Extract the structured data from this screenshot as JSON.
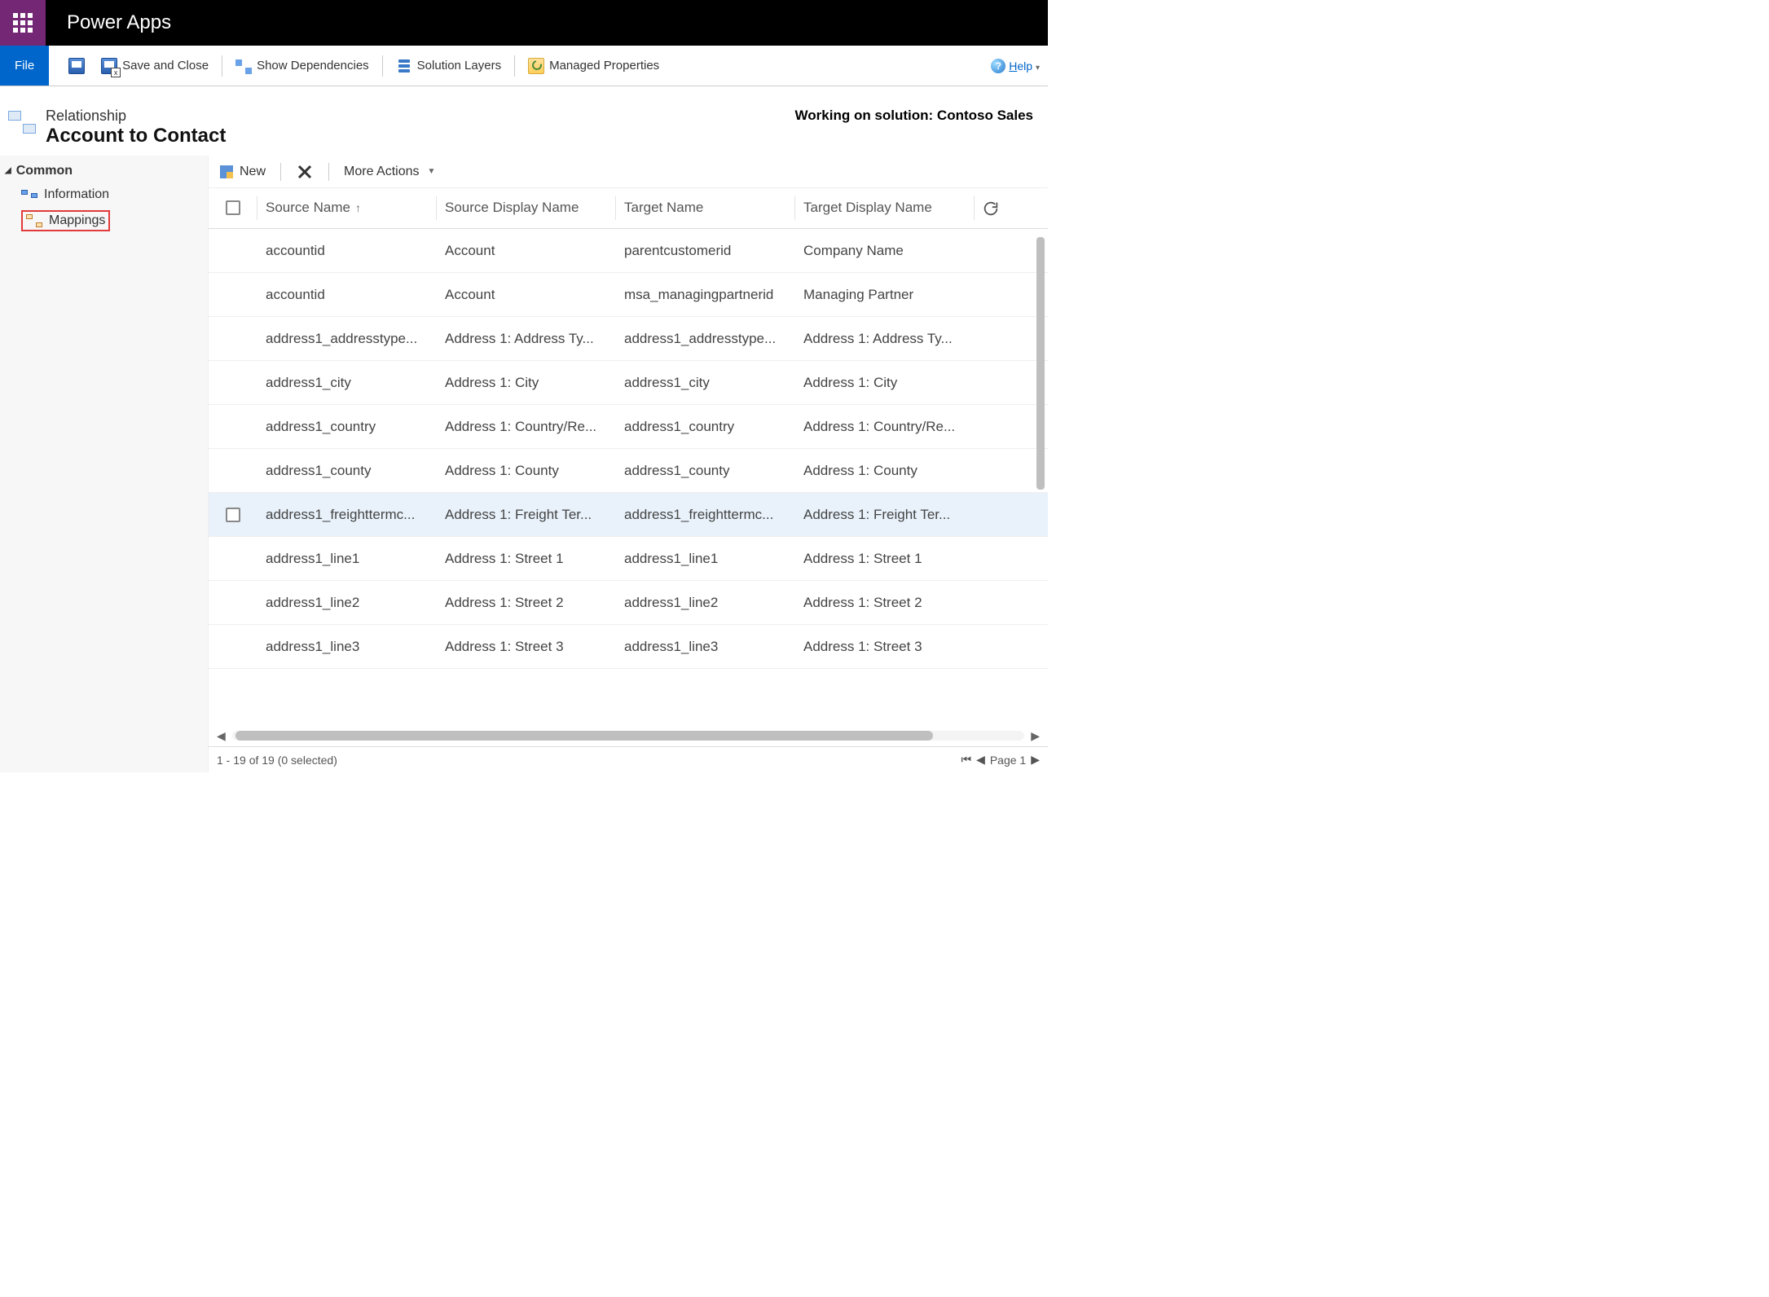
{
  "app_title": "Power Apps",
  "commands": {
    "file": "File",
    "save_close": "Save and Close",
    "show_dep": "Show Dependencies",
    "solution_layers": "Solution Layers",
    "managed_props": "Managed Properties",
    "help": "Help"
  },
  "header": {
    "crumb": "Relationship",
    "title": "Account to Contact",
    "solution": "Working on solution: Contoso Sales"
  },
  "sidebar": {
    "group": "Common",
    "items": [
      {
        "label": "Information"
      },
      {
        "label": "Mappings"
      }
    ]
  },
  "grid_toolbar": {
    "new": "New",
    "more": "More Actions"
  },
  "grid": {
    "columns": [
      "Source Name",
      "Source Display Name",
      "Target Name",
      "Target Display Name"
    ],
    "rows": [
      {
        "sn": "accountid",
        "sdn": "Account",
        "tn": "parentcustomerid",
        "tdn": "Company Name"
      },
      {
        "sn": "accountid",
        "sdn": "Account",
        "tn": "msa_managingpartnerid",
        "tdn": "Managing Partner"
      },
      {
        "sn": "address1_addresstype...",
        "sdn": "Address 1: Address Ty...",
        "tn": "address1_addresstype...",
        "tdn": "Address 1: Address Ty..."
      },
      {
        "sn": "address1_city",
        "sdn": "Address 1: City",
        "tn": "address1_city",
        "tdn": "Address 1: City"
      },
      {
        "sn": "address1_country",
        "sdn": "Address 1: Country/Re...",
        "tn": "address1_country",
        "tdn": "Address 1: Country/Re..."
      },
      {
        "sn": "address1_county",
        "sdn": "Address 1: County",
        "tn": "address1_county",
        "tdn": "Address 1: County"
      },
      {
        "sn": "address1_freighttermc...",
        "sdn": "Address 1: Freight Ter...",
        "tn": "address1_freighttermc...",
        "tdn": "Address 1: Freight Ter...",
        "hover": true
      },
      {
        "sn": "address1_line1",
        "sdn": "Address 1: Street 1",
        "tn": "address1_line1",
        "tdn": "Address 1: Street 1"
      },
      {
        "sn": "address1_line2",
        "sdn": "Address 1: Street 2",
        "tn": "address1_line2",
        "tdn": "Address 1: Street 2"
      },
      {
        "sn": "address1_line3",
        "sdn": "Address 1: Street 3",
        "tn": "address1_line3",
        "tdn": "Address 1: Street 3"
      }
    ]
  },
  "footer": {
    "status": "1 - 19 of 19 (0 selected)",
    "page": "Page 1"
  }
}
